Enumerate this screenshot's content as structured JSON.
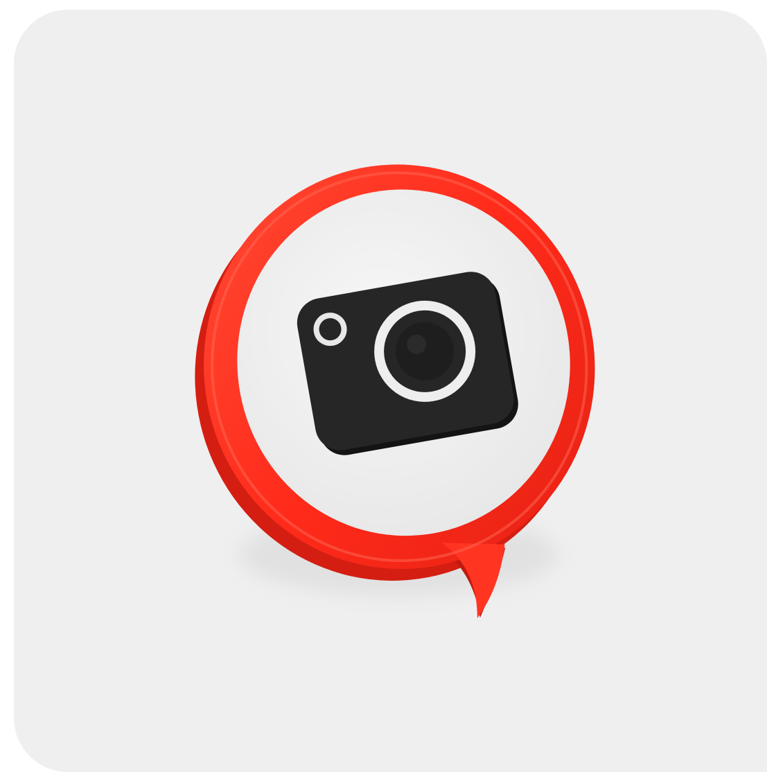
{
  "icon": {
    "name": "camera-speech-bubble-icon",
    "colors": {
      "background": "#efefef",
      "ring": "#ff2f1f",
      "ring_shadow": "#c81d12",
      "bubble_face": "#f4f4f4",
      "camera_body": "#262626",
      "lens_ring": "#efefef"
    }
  }
}
